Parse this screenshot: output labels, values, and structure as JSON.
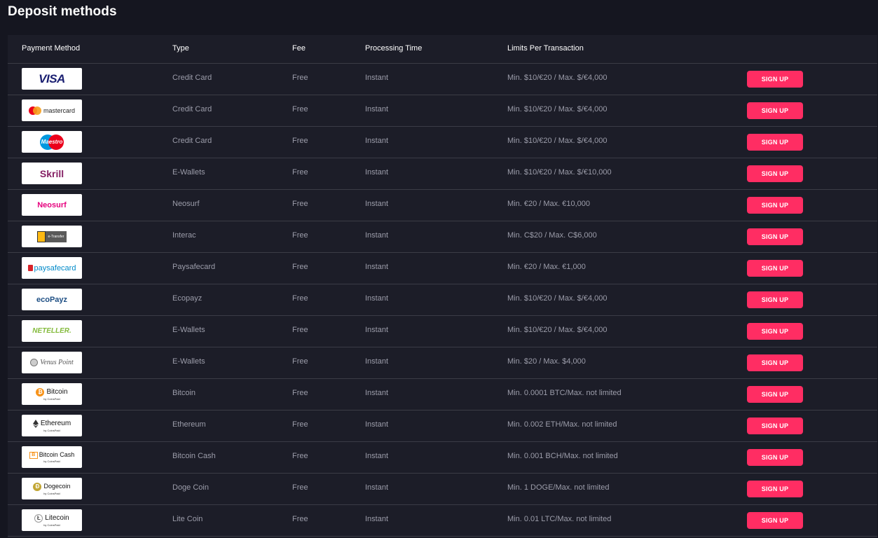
{
  "page": {
    "title": "Deposit methods"
  },
  "table": {
    "headers": {
      "method": "Payment Method",
      "type": "Type",
      "fee": "Fee",
      "processing": "Processing Time",
      "limits": "Limits Per Transaction"
    },
    "rows": [
      {
        "logo": "VISA",
        "type": "Credit Card",
        "fee": "Free",
        "processing": "Instant",
        "limits": "Min. $10/€20 / Max. $/€4,000",
        "button": "SIGN UP"
      },
      {
        "logo": "mastercard",
        "type": "Credit Card",
        "fee": "Free",
        "processing": "Instant",
        "limits": "Min. $10/€20 / Max. $/€4,000",
        "button": "SIGN UP"
      },
      {
        "logo": "Maestro",
        "type": "Credit Card",
        "fee": "Free",
        "processing": "Instant",
        "limits": "Min. $10/€20 / Max. $/€4,000",
        "button": "SIGN UP"
      },
      {
        "logo": "Skrill",
        "type": "E-Wallets",
        "fee": "Free",
        "processing": "Instant",
        "limits": "Min. $10/€20 / Max. $/€10,000",
        "button": "SIGN UP"
      },
      {
        "logo": "Neosurf",
        "type": "Neosurf",
        "fee": "Free",
        "processing": "Instant",
        "limits": "Min. €20 / Max. €10,000",
        "button": "SIGN UP"
      },
      {
        "logo": "e-Transfer",
        "type": "Interac",
        "fee": "Free",
        "processing": "Instant",
        "limits": "Min. C$20 / Max. C$6,000",
        "button": "SIGN UP"
      },
      {
        "logo": "paysafecard",
        "type": "Paysafecard",
        "fee": "Free",
        "processing": "Instant",
        "limits": "Min. €20 / Max. €1,000",
        "button": "SIGN UP"
      },
      {
        "logo": "ecoPayz",
        "type": "Ecopayz",
        "fee": "Free",
        "processing": "Instant",
        "limits": "Min. $10/€20 / Max. $/€4,000",
        "button": "SIGN UP"
      },
      {
        "logo": "NETELLER.",
        "type": "E-Wallets",
        "fee": "Free",
        "processing": "Instant",
        "limits": "Min. $10/€20 / Max. $/€4,000",
        "button": "SIGN UP"
      },
      {
        "logo": "Venus Point",
        "type": "E-Wallets",
        "fee": "Free",
        "processing": "Instant",
        "limits": "Min. $20 / Max. $4,000",
        "button": "SIGN UP"
      },
      {
        "logo": "Bitcoin",
        "type": "Bitcoin",
        "fee": "Free",
        "processing": "Instant",
        "limits": "Min. 0.0001 BTC/Max. not limited",
        "button": "SIGN UP"
      },
      {
        "logo": "Ethereum",
        "type": "Ethereum",
        "fee": "Free",
        "processing": "Instant",
        "limits": "Min. 0.002 ETH/Max. not limited",
        "button": "SIGN UP"
      },
      {
        "logo": "Bitcoin Cash",
        "type": "Bitcoin Cash",
        "fee": "Free",
        "processing": "Instant",
        "limits": "Min. 0.001 BCH/Max. not limited",
        "button": "SIGN UP"
      },
      {
        "logo": "Dogecoin",
        "type": "Doge Coin",
        "fee": "Free",
        "processing": "Instant",
        "limits": "Min. 1 DOGE/Max. not limited",
        "button": "SIGN UP"
      },
      {
        "logo": "Litecoin",
        "type": "Lite Coin",
        "fee": "Free",
        "processing": "Instant",
        "limits": "Min. 0.01 LTC/Max. not limited",
        "button": "SIGN UP"
      }
    ]
  },
  "logos": {
    "coinspaid": "by CoinsPaid"
  },
  "colors": {
    "accent": "#ff2d63",
    "background": "#151620",
    "panel": "#1c1d28"
  }
}
